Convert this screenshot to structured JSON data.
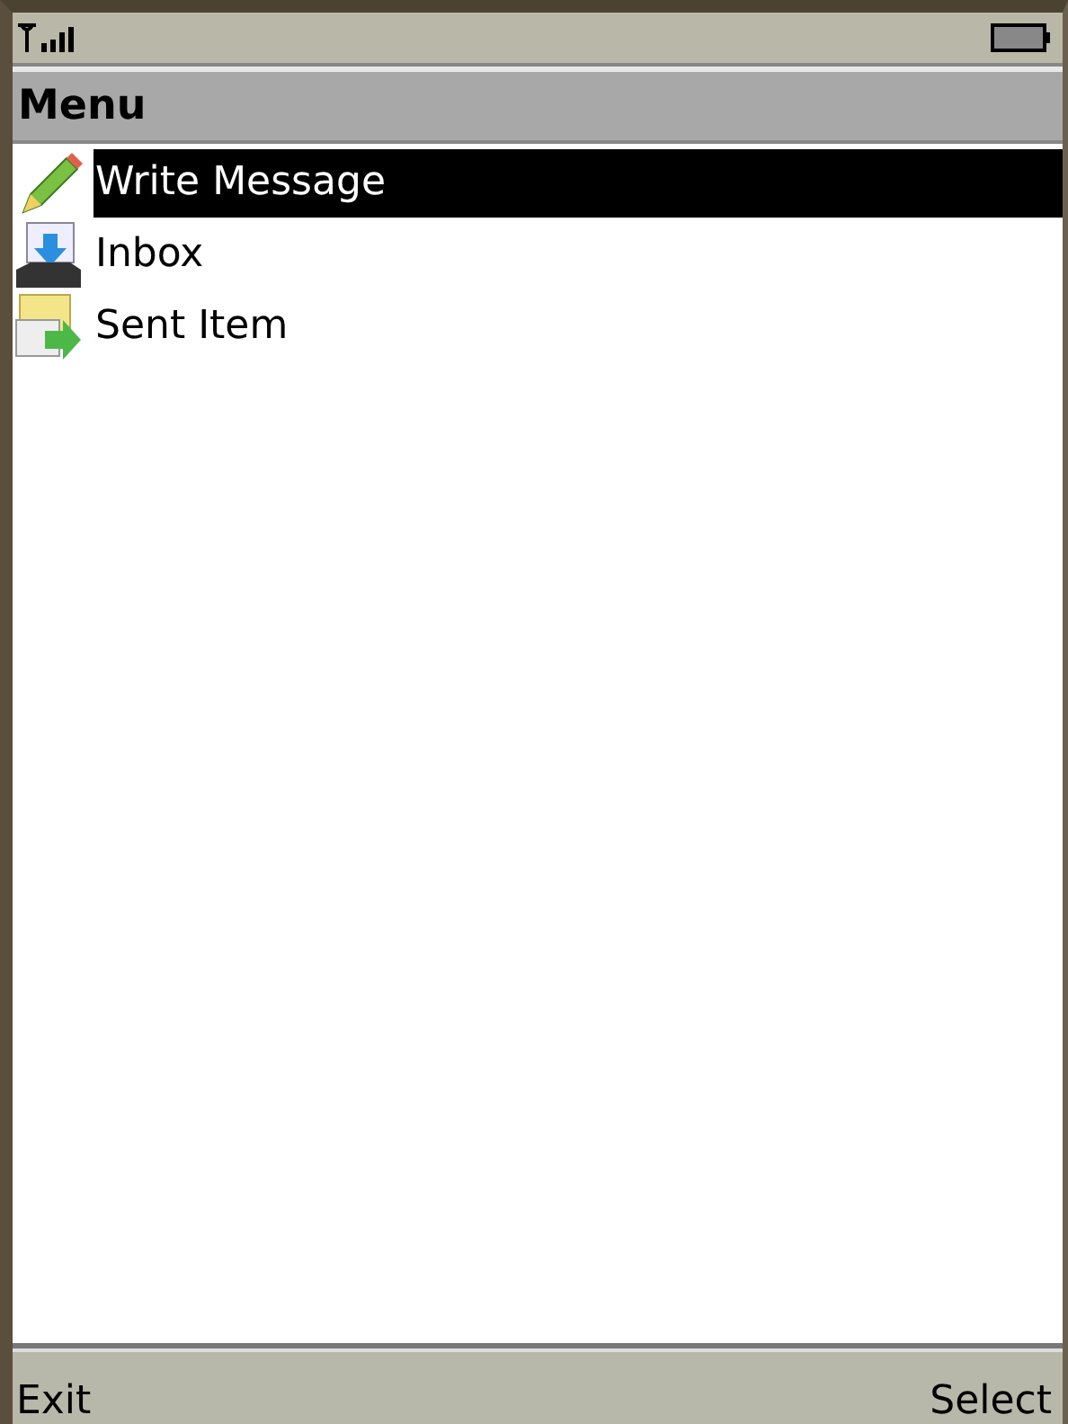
{
  "title": "Menu",
  "items": [
    {
      "label": "Write Message",
      "kind": "write",
      "selected": true
    },
    {
      "label": "Inbox",
      "kind": "inbox",
      "selected": false
    },
    {
      "label": "Sent Item",
      "kind": "sent",
      "selected": false
    }
  ],
  "softkeys": {
    "left": "Exit",
    "right": "Select"
  }
}
